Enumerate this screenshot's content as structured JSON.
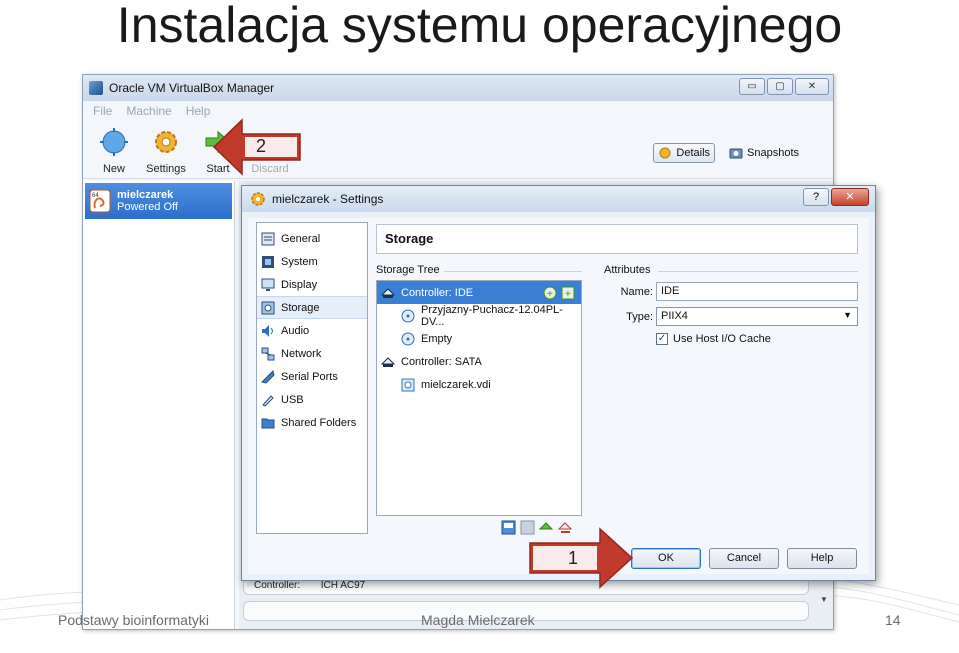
{
  "slide": {
    "title": "Instalacja systemu operacyjnego",
    "footer_left": "Podstawy bioinformatyki",
    "footer_center": "Magda Mielczarek",
    "page_number": "14"
  },
  "manager": {
    "title": "Oracle VM VirtualBox Manager",
    "window_buttons": [
      "▭",
      "▢",
      "✕"
    ],
    "menu": [
      "File",
      "Machine",
      "Help"
    ],
    "toolbar": [
      {
        "label": "New",
        "icon": "new-icon"
      },
      {
        "label": "Settings",
        "icon": "gear-icon"
      },
      {
        "label": "Start",
        "icon": "start-arrow-icon"
      },
      {
        "label": "Discard",
        "icon": "discard-icon"
      }
    ],
    "details_label": "Details",
    "snapshots_label": "Snapshots",
    "vm": {
      "name": "mielczarek",
      "state": "Powered Off",
      "badge": "64"
    },
    "controller_label": "Controller:",
    "controller_value": "ICH AC97"
  },
  "dialog": {
    "title": "mielczarek - Settings",
    "help_glyph": "?",
    "close_glyph": "✕",
    "categories": [
      {
        "label": "General",
        "icon": "general-icon"
      },
      {
        "label": "System",
        "icon": "system-icon"
      },
      {
        "label": "Display",
        "icon": "display-icon"
      },
      {
        "label": "Storage",
        "icon": "storage-icon",
        "selected": true
      },
      {
        "label": "Audio",
        "icon": "audio-icon"
      },
      {
        "label": "Network",
        "icon": "network-icon"
      },
      {
        "label": "Serial Ports",
        "icon": "serial-ports-icon"
      },
      {
        "label": "USB",
        "icon": "usb-icon"
      },
      {
        "label": "Shared Folders",
        "icon": "shared-folders-icon"
      }
    ],
    "page_title": "Storage",
    "storage_tree_label": "Storage Tree",
    "tree": [
      {
        "label": "Controller: IDE",
        "type": "controller",
        "selected": true
      },
      {
        "label": "Przyjazny-Puchacz-12.04PL-DV...",
        "type": "optical"
      },
      {
        "label": "Empty",
        "type": "optical"
      },
      {
        "label": "Controller: SATA",
        "type": "controller"
      },
      {
        "label": "mielczarek.vdi",
        "type": "disk"
      }
    ],
    "attributes_label": "Attributes",
    "name_label": "Name:",
    "name_value": "IDE",
    "type_label": "Type:",
    "type_value": "PIIX4",
    "host_cache_label": "Use Host I/O Cache",
    "host_cache_checked": true,
    "ok_label": "OK",
    "cancel_label": "Cancel",
    "help_label": "Help"
  },
  "annotations": {
    "arrow_1": "1",
    "arrow_2": "2",
    "color": "#c0392b"
  }
}
